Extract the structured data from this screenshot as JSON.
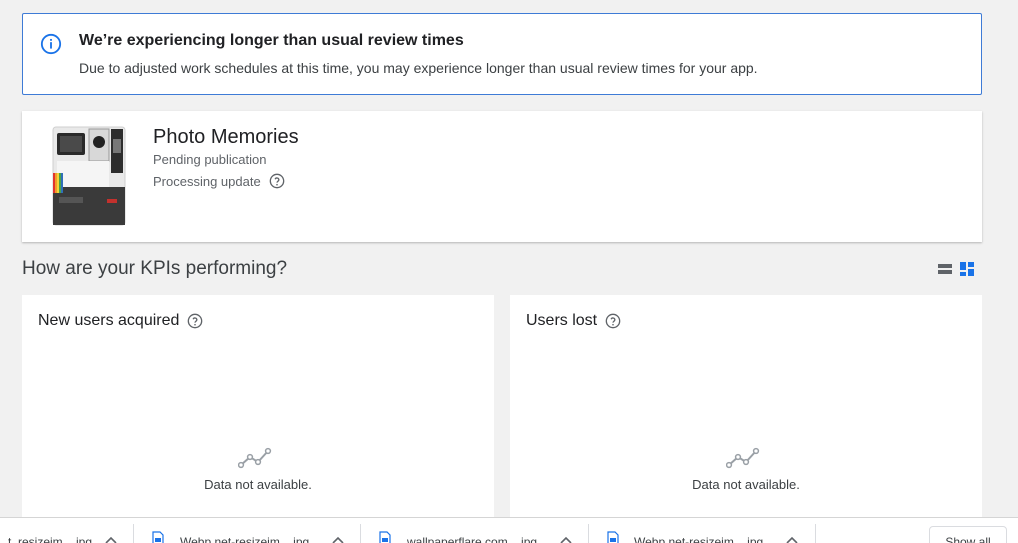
{
  "banner": {
    "icon": "info-icon",
    "title": "We’re experiencing longer than usual review times",
    "body": "Due to adjusted work schedules at this time, you may experience longer than usual review times for your app."
  },
  "app": {
    "icon": "instant-camera-app-icon",
    "name": "Photo Memories",
    "status": "Pending publication",
    "update": "Processing update"
  },
  "kpi": {
    "heading": "How are your KPIs performing?",
    "view_toggle": [
      "list-view-icon",
      "grid-view-icon"
    ],
    "cards": [
      {
        "title": "New users acquired",
        "empty": "Data not available."
      },
      {
        "title": "Users lost",
        "empty": "Data not available."
      }
    ]
  },
  "downloads": {
    "items": [
      {
        "name": "...t_resizeim....jpg"
      },
      {
        "name": "Webp.net-resizeim....jpg"
      },
      {
        "name": "wallpaperflare.com....jpg"
      },
      {
        "name": "Webp.net-resizeim....jpg"
      }
    ],
    "show_all": "Show all"
  },
  "colors": {
    "accent": "#1a73e8",
    "banner_border": "#3e7bd6",
    "background": "#f1f1f1"
  }
}
